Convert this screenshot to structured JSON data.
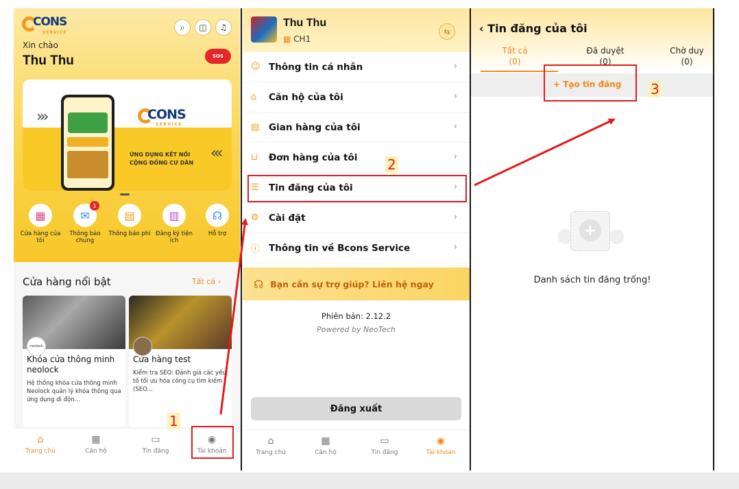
{
  "panel1": {
    "logo_text": "CONS",
    "logo_sub": "SERVICE",
    "greeting": "Xin chào",
    "user_name": "Thu Thu",
    "sos_label": "SOS",
    "banner": {
      "tagline_1": "ỨNG DỤNG KẾT NỐI",
      "tagline_2": "CỘNG ĐỒNG CƯ DÂN"
    },
    "quick_actions": [
      {
        "label": "Cửa hàng của tôi",
        "icon": "store-icon"
      },
      {
        "label": "Thông báo chung",
        "icon": "megaphone-icon",
        "badge": "1"
      },
      {
        "label": "Thông báo phí",
        "icon": "invoice-icon"
      },
      {
        "label": "Đăng ký tiện ích",
        "icon": "calendar-icon"
      },
      {
        "label": "Hỗ trợ",
        "icon": "headset-icon"
      }
    ],
    "featured_title": "Cửa hàng nổi bật",
    "see_all": "Tất cả",
    "stores": [
      {
        "title": "Khóa cửa thông minh neolock",
        "avatar": "neolock",
        "desc": "Hệ thống khóa cửa thông minh Neolock quản lý khóa thông qua ứng dụng di độn..."
      },
      {
        "title": "Cửa hàng test",
        "avatar": "",
        "desc": "Kiểm tra SEO: Đánh giá các yếu tố tối ưu hóa công cụ tìm kiếm (SEO..."
      }
    ],
    "tabs": [
      {
        "label": "Trang chủ",
        "icon": "home-icon"
      },
      {
        "label": "Căn hộ",
        "icon": "building-icon"
      },
      {
        "label": "Tin đăng",
        "icon": "post-icon"
      },
      {
        "label": "Tài khoản",
        "icon": "account-icon"
      }
    ]
  },
  "panel2": {
    "name": "Thu Thu",
    "apartment": "CH1",
    "menu": [
      {
        "label": "Thông tin cá nhân",
        "icon": "user-icon"
      },
      {
        "label": "Căn hộ của tôi",
        "icon": "home-icon"
      },
      {
        "label": "Gian hàng của tôi",
        "icon": "shop-icon"
      },
      {
        "label": "Đơn hàng của tôi",
        "icon": "cart-icon"
      },
      {
        "label": "Tin đăng của tôi",
        "icon": "list-icon"
      },
      {
        "label": "Cài đặt",
        "icon": "settings-icon"
      },
      {
        "label": "Thông tin về Bcons Service",
        "icon": "info-icon"
      }
    ],
    "help": "Bạn cần sự trợ giúp? Liên hệ ngay",
    "version": "Phiên bản: 2.12.2",
    "powered": "Powered by NeoTech",
    "logout": "Đăng xuất",
    "tabs": [
      {
        "label": "Trang chủ"
      },
      {
        "label": "Căn hộ"
      },
      {
        "label": "Tin đăng"
      },
      {
        "label": "Tài khoản"
      }
    ]
  },
  "panel3": {
    "title": "Tin đăng của tôi",
    "tabs": [
      {
        "label": "Tất cả",
        "count": "(0)"
      },
      {
        "label": "Đã duyệt",
        "count": "(0)"
      },
      {
        "label": "Chờ duy",
        "count": "(0)"
      }
    ],
    "create": "+ Tạo tin đăng",
    "empty": "Danh sách tin đăng trống!"
  },
  "annotations": {
    "step1": "1",
    "step2": "2",
    "step3": "3",
    "highlight_color": "#e31b1b"
  },
  "colors": {
    "accent": "#f08a1a",
    "brand_yellow": "#fbd54f",
    "brand_blue": "#123a7a"
  }
}
